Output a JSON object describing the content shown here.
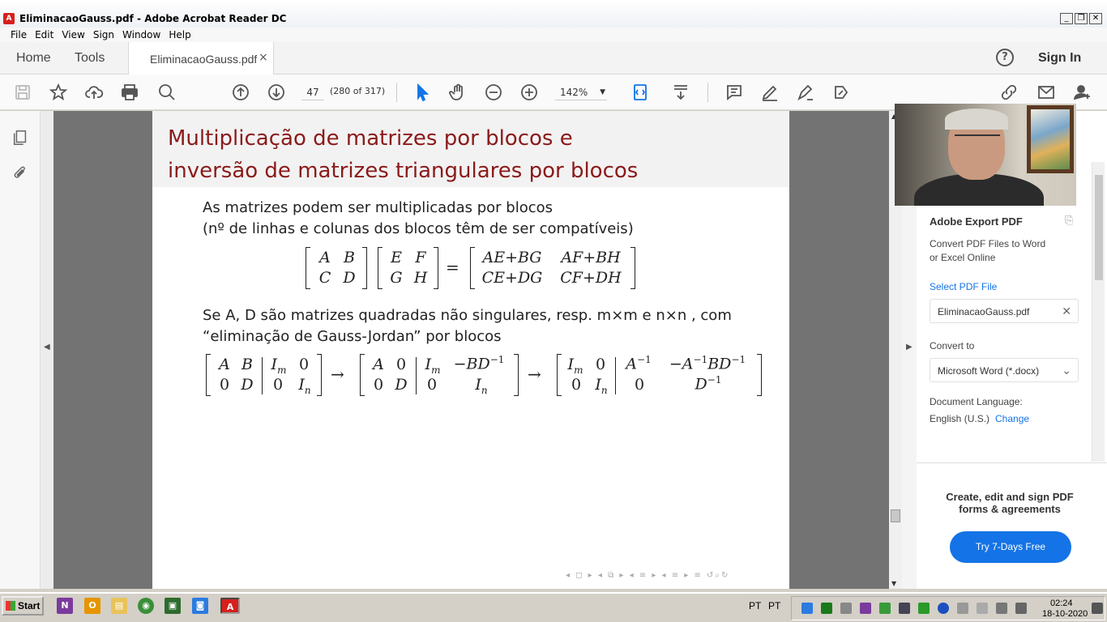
{
  "window": {
    "title": "EliminacaoGauss.pdf - Adobe Acrobat Reader DC",
    "minimize": "_",
    "restore": "❐",
    "close": "✕"
  },
  "menu": [
    "File",
    "Edit",
    "View",
    "Sign",
    "Window",
    "Help"
  ],
  "tabs": {
    "home": "Home",
    "tools": "Tools",
    "document": "EliminacaoGauss.pdf",
    "close_glyph": "×",
    "help_glyph": "?",
    "sign_in": "Sign In"
  },
  "toolbar": {
    "page_number": "47",
    "page_count": "(280 of 317)",
    "zoom": "142%",
    "zoom_arrow": "▼"
  },
  "slide": {
    "title_line1": "Multiplicação de matrizes por blocos e",
    "title_line2": "inversão de matrizes triangulares por blocos",
    "line1": "As matrizes podem ser multiplicadas por blocos",
    "line2": "(nº de linhas e colunas dos blocos têm de ser compatíveis)",
    "eq1": {
      "m1": [
        "A",
        "B",
        "C",
        "D"
      ],
      "m2": [
        "E",
        "F",
        "G",
        "H"
      ],
      "equals": "=",
      "m3": [
        "AE+BG",
        "AF+BH",
        "CE+DG",
        "CF+DH"
      ]
    },
    "line3": "Se A, D são matrizes quadradas não singulares, resp. m×m e n×n , com",
    "line4": "“eliminação de Gauss-Jordan” por blocos",
    "eq2": {
      "a": [
        "A",
        "B",
        "I",
        "m",
        "0",
        "0",
        "D",
        "0",
        "I",
        "n"
      ],
      "arrow": "→",
      "b": [
        "A",
        "0",
        "I",
        "m",
        "−BD",
        "−1",
        "0",
        "D",
        "0",
        "I",
        "n"
      ],
      "c": [
        "I",
        "m",
        "0",
        "A",
        "−1",
        "−A",
        "−1",
        "BD",
        "−1",
        "0",
        "I",
        "n",
        "0",
        "D",
        "−1"
      ]
    },
    "nav_icons": "◂ ◻ ▸ ◂ ⧉ ▸ ◂ ≡ ▸ ◂ ≡ ▸ ≡ ↺⌕↻"
  },
  "right_panel": {
    "heading": "Adobe Export PDF",
    "description_line1": "Convert PDF Files to Word",
    "description_line2": "or Excel Online",
    "select_link": "Select PDF File",
    "file_name": "EliminacaoGauss.pdf",
    "file_clear": "✕",
    "convert_label": "Convert to",
    "convert_value": "Microsoft Word (*.docx)",
    "convert_arrow": "⌄",
    "language_label": "Document Language:",
    "language_value": "English (U.S.)",
    "change_link": "Change",
    "promo_line1": "Create, edit and sign PDF",
    "promo_line2": "forms & agreements",
    "trial_button": "Try 7-Days Free"
  },
  "taskbar": {
    "start": "Start",
    "lang1": "PT",
    "lang2": "PT",
    "time": "02:24",
    "date": "18-10-2020"
  },
  "colors": {
    "accent": "#1473e6",
    "slide_title": "#8b1a1a",
    "viewer_bg": "#737373"
  }
}
